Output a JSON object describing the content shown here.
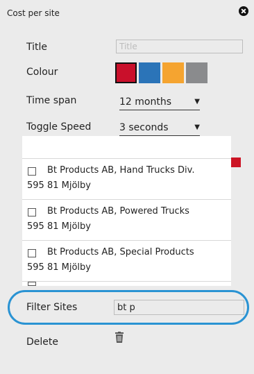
{
  "panel": {
    "title": "Cost per site",
    "title_field": {
      "label": "Title",
      "placeholder": "Title",
      "value": ""
    },
    "colour": {
      "label": "Colour",
      "swatches": [
        "#c9102b",
        "#2b74b8",
        "#f5a430",
        "#8a8b8d"
      ],
      "selected_index": 0
    },
    "time_span": {
      "label": "Time span",
      "value": "12 months"
    },
    "toggle_speed": {
      "label": "Toggle Speed",
      "value": "3 seconds"
    },
    "sites": [
      {
        "name": "Bt Products AB, Hand Trucks Div.",
        "address": "595 81 Mjölby",
        "checked": false
      },
      {
        "name": "Bt Products AB, Powered Trucks",
        "address": "595 81 Mjölby",
        "checked": false
      },
      {
        "name": "Bt Products AB, Special Products",
        "address": "595 81 Mjölby",
        "checked": false
      }
    ],
    "filter": {
      "label": "Filter Sites",
      "value": "bt p"
    },
    "delete": {
      "label": "Delete"
    },
    "colors": {
      "highlight": "#2a93d3",
      "scroll_thumb": "#cc1525"
    }
  }
}
